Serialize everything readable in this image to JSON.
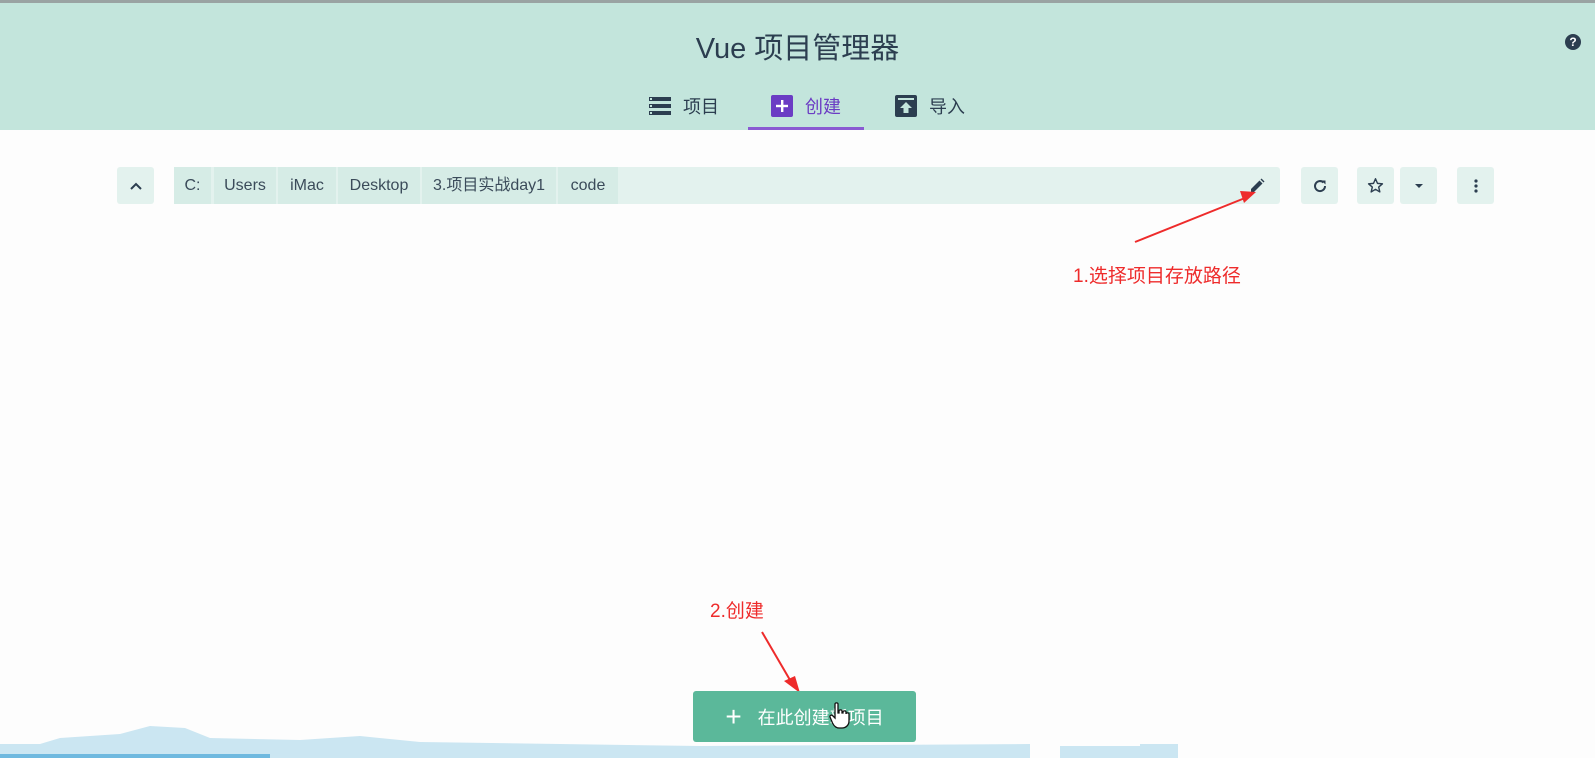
{
  "header": {
    "title": "Vue 项目管理器",
    "help_icon": "question-circle-icon",
    "tabs": [
      {
        "label": "项目",
        "icon": "list-icon",
        "active": false
      },
      {
        "label": "创建",
        "icon": "plus-box-icon",
        "active": true
      },
      {
        "label": "导入",
        "icon": "upload-box-icon",
        "active": false
      }
    ]
  },
  "toolbar": {
    "up_icon": "chevron-up-icon",
    "breadcrumbs": [
      "C:",
      "Users",
      "iMac",
      "Desktop",
      "3.项目实战day1",
      "code"
    ],
    "edit_icon": "pencil-icon",
    "refresh_icon": "refresh-icon",
    "favorite_icon": "star-outline-icon",
    "favorites_dropdown_icon": "caret-down-icon",
    "more_icon": "more-vertical-icon"
  },
  "annotations": {
    "step1": "1.选择项目存放路径",
    "step2": "2.创建"
  },
  "main": {
    "create_button_label": "在此创建新项目",
    "create_button_icon": "plus-icon"
  },
  "colors": {
    "header_bg": "#c3e5dc",
    "accent_purple": "#6b3cc4",
    "primary_green": "#5bb89a",
    "annotation_red": "#ee2b2b"
  }
}
